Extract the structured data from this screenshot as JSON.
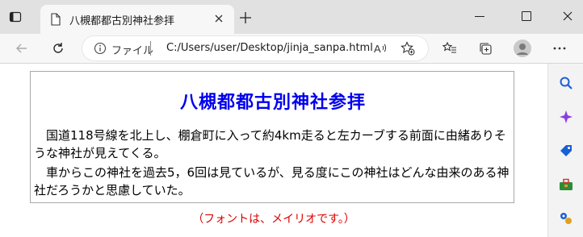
{
  "browser": {
    "tab_title": "八槻都都古別神社参拝",
    "address": {
      "scheme_label": "ファイル",
      "url": "C:/Users/user/Desktop/jinja_sanpa.html"
    }
  },
  "page": {
    "title": "八槻都都古別神社参拝",
    "paragraph1": "　国道118号線を北上し、棚倉町に入って約4km走ると左カーブする前面に由緒ありそうな神社が見えてくる。",
    "paragraph2": "　車からこの神社を過去5，6回は見ているが、見る度にこの神社はどんな由来のある神社だろうかと思慮していた。",
    "note": "（フォントは、メイリオです。）"
  },
  "icons": {
    "tab": [
      "tab-actions-icon",
      "page-icon",
      "close-icon",
      "new-tab-icon"
    ],
    "window": [
      "minimize-icon",
      "maximize-icon",
      "close-window-icon"
    ],
    "toolbar": [
      "back-icon",
      "refresh-icon",
      "info-icon",
      "read-aloud-icon",
      "add-favorite-icon",
      "favorites-icon",
      "collections-icon",
      "profile-icon",
      "more-icon"
    ],
    "sidebar": [
      "search-icon",
      "copilot-icon",
      "shopping-icon",
      "tools-icon",
      "games-icon"
    ]
  },
  "colors": {
    "title": "#0000ee",
    "note": "#dd0000",
    "tab_strip": "#e1e1e1",
    "toolbar": "#f7f7f7"
  }
}
